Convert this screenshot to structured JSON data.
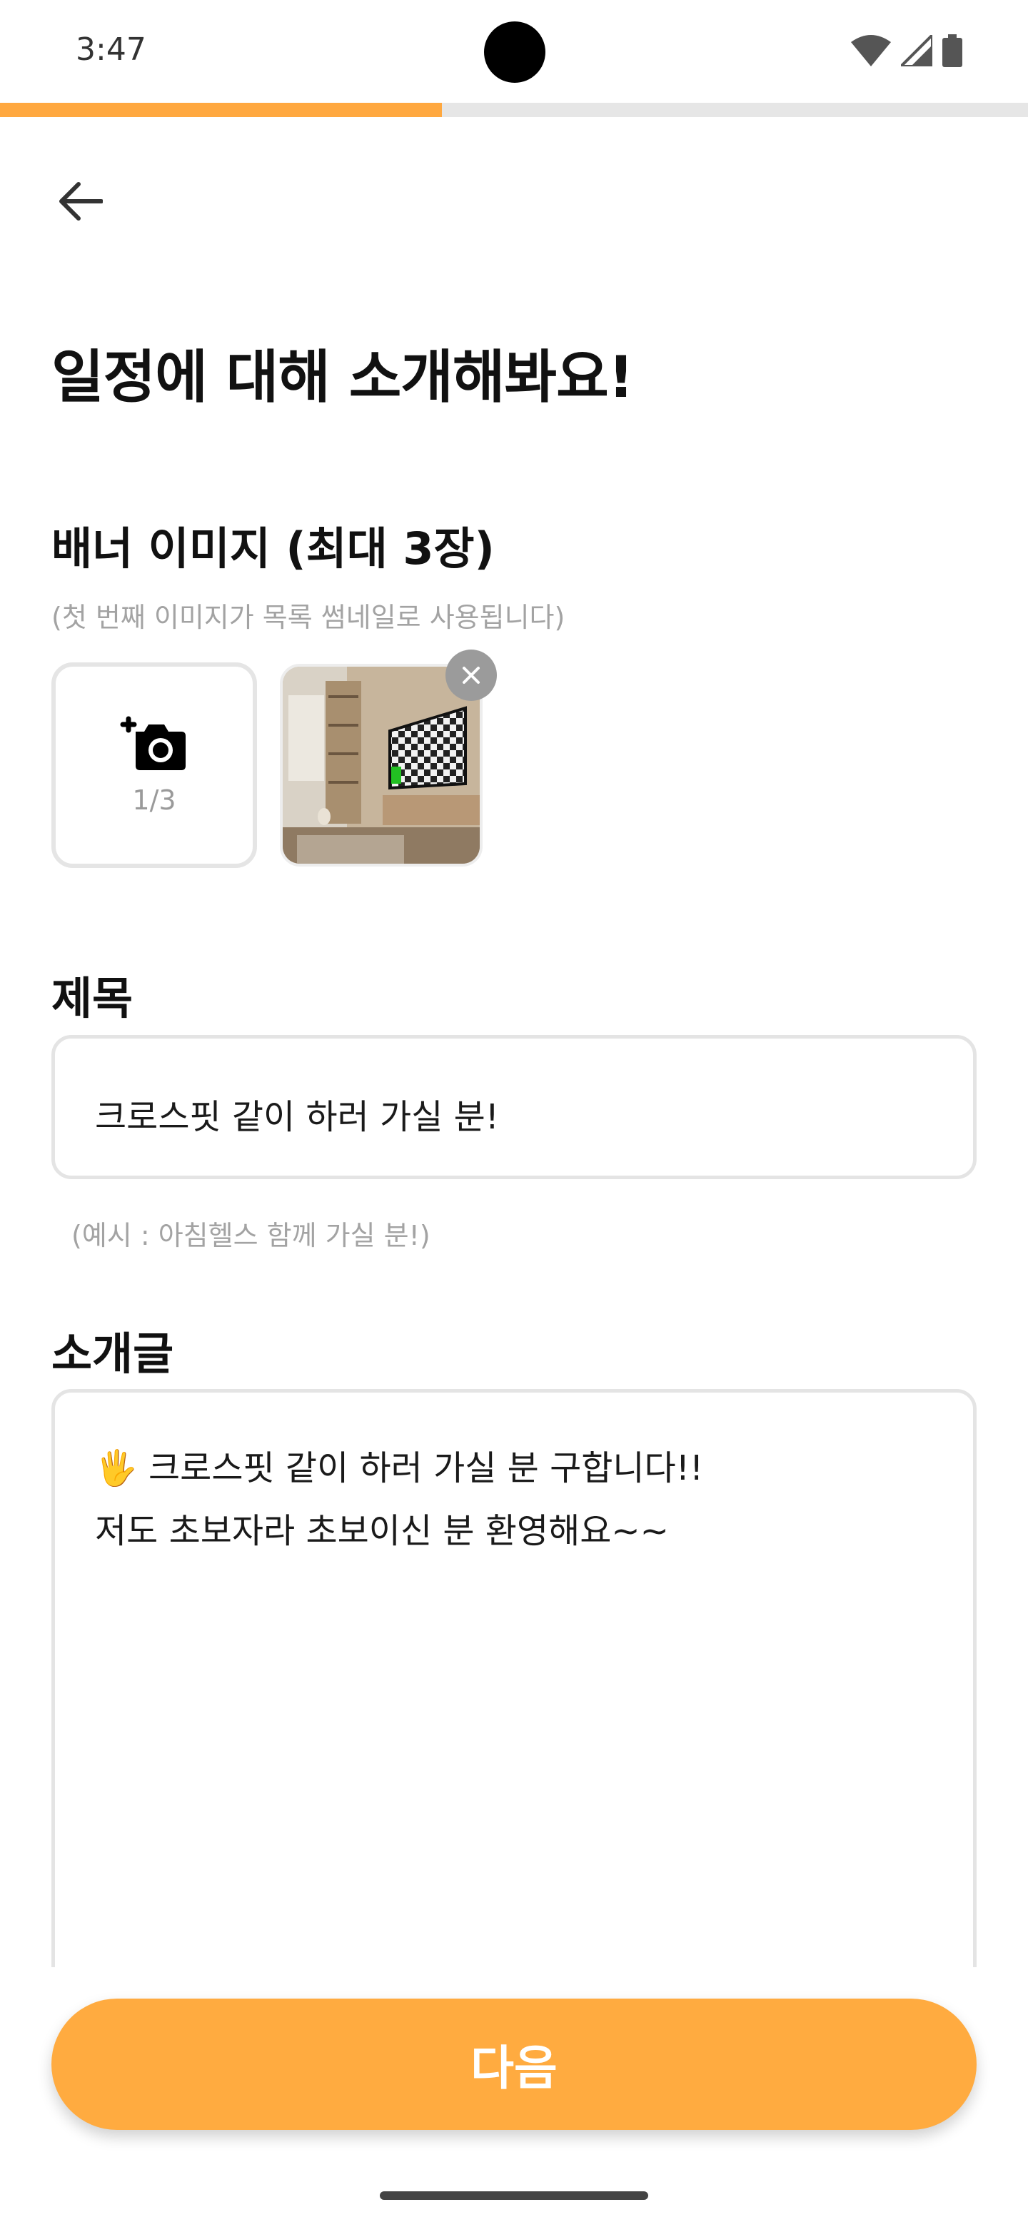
{
  "status_bar": {
    "time": "3:47"
  },
  "progress": {
    "fraction": 0.43,
    "color": "#ffa83f"
  },
  "page": {
    "title": "일정에 대해 소개해봐요!"
  },
  "banner": {
    "label": "배너 이미지 (최대 3장)",
    "hint": "(첫 번째 이미지가 목록 썸네일로 사용됩니다)",
    "count": "1/3",
    "add_icon": "add-camera-icon",
    "remove_icon": "close-icon"
  },
  "title_section": {
    "label": "제목",
    "value": "크로스핏 같이 하러 가실 분!",
    "hint": "(예시 : 아침헬스 함께 가실 분!)"
  },
  "intro_section": {
    "label": "소개글",
    "lines": [
      "🖐 크로스핏 같이 하러 가실 분 구합니다!!",
      "저도 초보자라 초보이신 분 환영해요~~"
    ]
  },
  "next_button": {
    "label": "다음",
    "color": "#ffab40"
  }
}
